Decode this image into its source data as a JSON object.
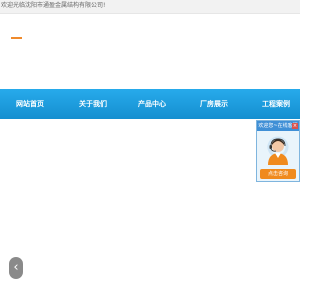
{
  "topbar": {
    "welcome_text": "欢迎光临沈阳市通盈金属结构有限公司!"
  },
  "nav": {
    "items": [
      {
        "label": "网站首页"
      },
      {
        "label": "关于我们"
      },
      {
        "label": "产品中心"
      },
      {
        "label": "厂房展示"
      },
      {
        "label": "工程案例"
      }
    ]
  },
  "service": {
    "title": "欢迎您~在线客服",
    "close_label": "×",
    "consult_label": "点击咨询"
  },
  "slider": {
    "prev_label": "‹"
  },
  "colors": {
    "nav_bg": "#1a9fde",
    "accent_orange": "#ef8a2c",
    "service_header": "#3f8fd6"
  },
  "icons": [
    "logo-mark",
    "customer-service-agent-icon",
    "chevron-left-icon"
  ]
}
